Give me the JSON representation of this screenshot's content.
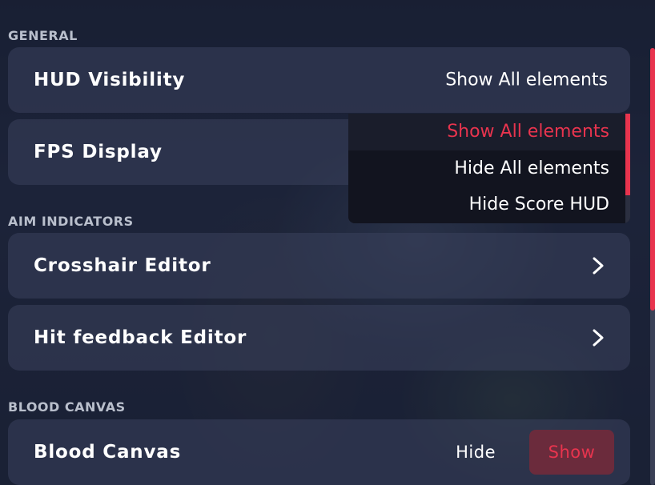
{
  "colors": {
    "accent": "#e8344e",
    "toggle_active_bg": "#6b2b3c"
  },
  "sections": {
    "general": "GENERAL",
    "aim_indicators": "AIM INDICATORS",
    "blood_canvas": "BLOOD CANVAS"
  },
  "rows": {
    "hud_visibility": {
      "label": "HUD Visibility",
      "value": "Show All elements"
    },
    "fps_display": {
      "label": "FPS Display"
    },
    "crosshair_editor": {
      "label": "Crosshair Editor",
      "icon": "chevron-right-icon"
    },
    "hit_feedback_editor": {
      "label": "Hit feedback Editor",
      "icon": "chevron-right-icon"
    },
    "blood_canvas": {
      "label": "Blood Canvas",
      "off_label": "Hide",
      "on_label": "Show",
      "selected": "Show"
    }
  },
  "dropdown": {
    "options": [
      "Show All elements",
      "Hide All elements",
      "Hide Score HUD"
    ],
    "selected_index": 0
  }
}
